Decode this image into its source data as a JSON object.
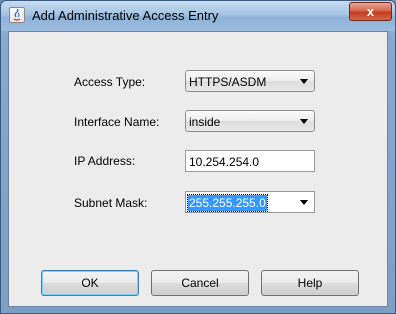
{
  "window": {
    "title": "Add Administrative Access Entry",
    "close_label": "x"
  },
  "form": {
    "access_type": {
      "label": "Access Type:",
      "value": "HTTPS/ASDM"
    },
    "interface_name": {
      "label": "Interface Name:",
      "value": "inside"
    },
    "ip_address": {
      "label": "IP Address:",
      "value": "10.254.254.0"
    },
    "subnet_mask": {
      "label": "Subnet Mask:",
      "value": "255.255.255.0"
    }
  },
  "buttons": {
    "ok": "OK",
    "cancel": "Cancel",
    "help": "Help"
  }
}
